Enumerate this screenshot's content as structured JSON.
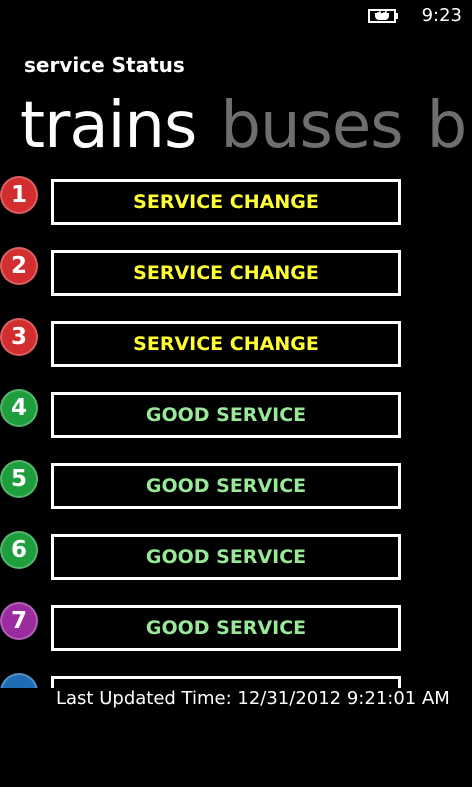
{
  "status_bar": {
    "battery_icon": "battery-charging-icon",
    "time": "9:23"
  },
  "app": {
    "title": "service Status"
  },
  "pivot": {
    "tabs": [
      {
        "label": "trains",
        "active": true
      },
      {
        "label": "buses",
        "active": false
      },
      {
        "label": "bi",
        "active": false
      }
    ]
  },
  "lines": [
    {
      "number": "1",
      "color": "#d22d2f",
      "status": "SERVICE CHANGE",
      "status_color": "#ffff33"
    },
    {
      "number": "2",
      "color": "#d22d2f",
      "status": "SERVICE CHANGE",
      "status_color": "#ffff33"
    },
    {
      "number": "3",
      "color": "#d22d2f",
      "status": "SERVICE CHANGE",
      "status_color": "#ffff33"
    },
    {
      "number": "4",
      "color": "#1f9e3e",
      "status": "GOOD SERVICE",
      "status_color": "#98e898"
    },
    {
      "number": "5",
      "color": "#1f9e3e",
      "status": "GOOD SERVICE",
      "status_color": "#98e898"
    },
    {
      "number": "6",
      "color": "#1f9e3e",
      "status": "GOOD SERVICE",
      "status_color": "#98e898"
    },
    {
      "number": "7",
      "color": "#9b2ca0",
      "status": "GOOD SERVICE",
      "status_color": "#98e898"
    },
    {
      "number": "",
      "color": "#1e6db3",
      "status": "",
      "status_color": "#98e898"
    }
  ],
  "footer": {
    "last_updated": "Last Updated Time: 12/31/2012 9:21:01 AM"
  }
}
